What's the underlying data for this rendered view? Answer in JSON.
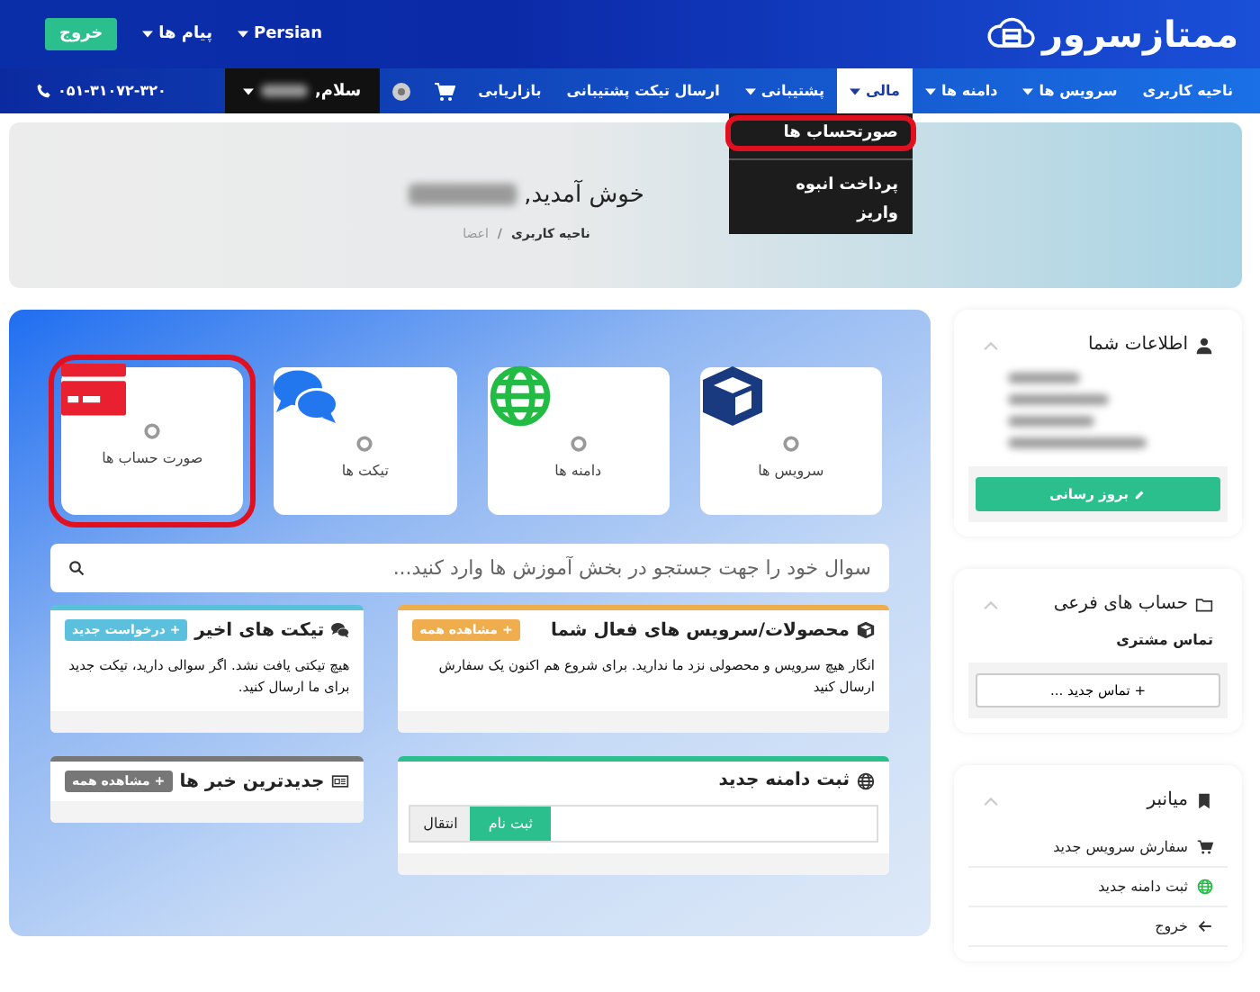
{
  "header": {
    "logo": "ممتازسرور",
    "top_links": [
      {
        "label": "Persian",
        "caret": true
      },
      {
        "label": "پیام ها",
        "caret": true
      }
    ],
    "logout_button": "خروج"
  },
  "nav": {
    "items": [
      {
        "label": "ناحیه کاربری",
        "caret": false,
        "selected": false
      },
      {
        "label": "سرویس ها",
        "caret": true,
        "selected": false
      },
      {
        "label": "دامنه ها",
        "caret": true,
        "selected": false
      },
      {
        "label": "مالی",
        "caret": true,
        "selected": true
      },
      {
        "label": "پشتیبانی",
        "caret": true,
        "selected": false
      },
      {
        "label": "ارسال تیکت پشتیبانی",
        "caret": false,
        "selected": false
      },
      {
        "label": "بازاریابی",
        "caret": false,
        "selected": false
      }
    ],
    "greeting": "سلام,",
    "phone": "۰۵۱-۳۱۰۷۲-۳۲۰",
    "dropdown": [
      {
        "kind": "link",
        "label": "صورتحساب ها",
        "highlighted": true
      },
      {
        "kind": "divider"
      },
      {
        "kind": "link",
        "label": "پرداخت انبوه",
        "highlighted": false
      },
      {
        "kind": "link",
        "label": "واریز",
        "highlighted": false
      }
    ]
  },
  "page_header": {
    "title": "خوش آمدید,",
    "separator": "/",
    "breadcrumb": [
      {
        "label": "ناحیه کاربری",
        "active": false
      },
      {
        "label": "اعضا",
        "active": true
      }
    ]
  },
  "tiles": [
    {
      "kind": "services",
      "label": "سرویس ها",
      "highlighted": false
    },
    {
      "kind": "domains",
      "label": "دامنه ها",
      "highlighted": false
    },
    {
      "kind": "tickets",
      "label": "تیکت ها",
      "highlighted": false
    },
    {
      "kind": "invoices",
      "label": "صورت حساب ها",
      "highlighted": true
    }
  ],
  "search": {
    "placeholder": "سوال خود را جهت جستجو در بخش آموزش ها وارد کنید..."
  },
  "columns": [
    [
      {
        "kind": "services",
        "title": "محصولات/سرویس های فعال شما",
        "color": "#f0ad4e",
        "button": "+ مشاهده همه",
        "text": "انگار هیچ سرویس و محصولی نزد ما ندارید. برای شروع هم اکنون یک سفارش ارسال کنید"
      },
      {
        "kind": "domains",
        "title": "ثبت دامنه جدید",
        "color": "#2bbf8e",
        "domain_form": {
          "register": "ثبت نام",
          "transfer": "انتقال"
        }
      }
    ],
    [
      {
        "kind": "tickets",
        "title": "تیکت های اخیر",
        "color": "#5bc0de",
        "button": "+ درخواست جدید",
        "text": "هیچ تیکتی یافت نشد. اگر سوالی دارید، تیکت جدید برای ما ارسال کنید."
      },
      {
        "kind": "news",
        "title": "جدیدترین خبر ها",
        "color": "#777777",
        "button": "+ مشاهده همه"
      }
    ]
  ],
  "sidebar": [
    {
      "kind": "info",
      "title": "اطلاعات شما",
      "button": "بروز رسانی"
    },
    {
      "kind": "contacts",
      "title": "حساب های فرعی",
      "text": "تماس مشتری",
      "button": "+ تماس جدید ..."
    },
    {
      "kind": "links",
      "title": "میانبر",
      "links": [
        {
          "label": "سفارش سرویس جدید"
        },
        {
          "label": "ثبت دامنه جدید"
        },
        {
          "label": "خروج"
        }
      ]
    }
  ]
}
